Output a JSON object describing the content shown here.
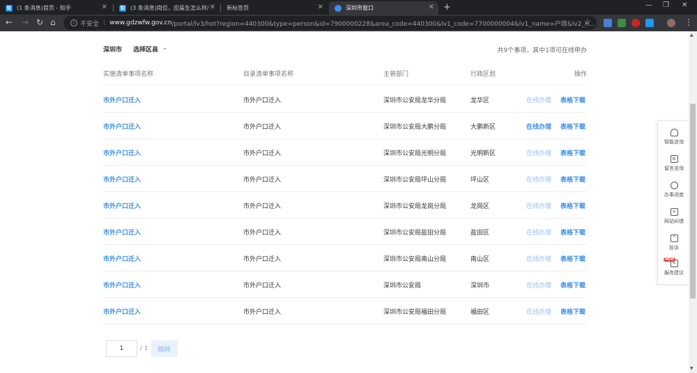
{
  "browser": {
    "tabs": [
      {
        "title": "(1 条消息)首页 - 知乎",
        "favicon": "知",
        "active": false
      },
      {
        "title": "(3 条消息)岗位，应届生怎么样/ ...",
        "favicon": "知",
        "active": false
      },
      {
        "title": "新标签页",
        "favicon": "",
        "active": false
      },
      {
        "title": "深圳市窗口",
        "favicon": "gov",
        "active": true
      }
    ],
    "security_label": "不安全",
    "url_domain": "www.gdzwfw.gov.cn",
    "url_path": "/portal/lv3/hot?region=440300&type=person&id=7900000228&area_code=440300&lv1_code=7700000004&lv1_name=户政&lv2_n..."
  },
  "filter": {
    "city": "深圳市",
    "district_label": "选择区县",
    "summary": "共9个事项，其中1项可在线申办"
  },
  "table": {
    "headers": [
      "实施清单事项名称",
      "目录清单事项名称",
      "主管部门",
      "行政区划",
      "操作"
    ],
    "rows": [
      {
        "name": "市外户口迁入",
        "catalog": "市外户口迁入",
        "dept": "深圳市公安局龙华分局",
        "region": "龙华区",
        "online": "在线办理",
        "online_enabled": false,
        "download": "表格下载"
      },
      {
        "name": "市外户口迁入",
        "catalog": "市外户口迁入",
        "dept": "深圳市公安局大鹏分局",
        "region": "大鹏新区",
        "online": "在线办理",
        "online_enabled": true,
        "download": "表格下载"
      },
      {
        "name": "市外户口迁入",
        "catalog": "市外户口迁入",
        "dept": "深圳市公安局光明分局",
        "region": "光明新区",
        "online": "在线办理",
        "online_enabled": false,
        "download": "表格下载"
      },
      {
        "name": "市外户口迁入",
        "catalog": "市外户口迁入",
        "dept": "深圳市公安局坪山分局",
        "region": "坪山区",
        "online": "在线办理",
        "online_enabled": false,
        "download": "表格下载"
      },
      {
        "name": "市外户口迁入",
        "catalog": "市外户口迁入",
        "dept": "深圳市公安局龙岗分局",
        "region": "龙岗区",
        "online": "在线办理",
        "online_enabled": false,
        "download": "表格下载"
      },
      {
        "name": "市外户口迁入",
        "catalog": "市外户口迁入",
        "dept": "深圳市公安局盐田分局",
        "region": "盐田区",
        "online": "在线办理",
        "online_enabled": false,
        "download": "表格下载"
      },
      {
        "name": "市外户口迁入",
        "catalog": "市外户口迁入",
        "dept": "深圳市公安局南山分局",
        "region": "南山区",
        "online": "在线办理",
        "online_enabled": false,
        "download": "表格下载"
      },
      {
        "name": "市外户口迁入",
        "catalog": "市外户口迁入",
        "dept": "深圳市公安局",
        "region": "深圳市",
        "online": "在线办理",
        "online_enabled": false,
        "download": "表格下载"
      },
      {
        "name": "市外户口迁入",
        "catalog": "市外户口迁入",
        "dept": "深圳市公安局福田分局",
        "region": "福田区",
        "online": "在线办理",
        "online_enabled": false,
        "download": "表格下载"
      }
    ]
  },
  "pager": {
    "current": "1",
    "total": "/ 1",
    "go_label": "跳转"
  },
  "side_panel": [
    {
      "label": "智能咨询",
      "icon": "headset-icon"
    },
    {
      "label": "留言咨询",
      "icon": "message-icon"
    },
    {
      "label": "办事进度",
      "icon": "progress-icon"
    },
    {
      "label": "网站纠错",
      "icon": "error-report-icon"
    },
    {
      "label": "投诉",
      "icon": "complaint-icon"
    },
    {
      "label": "服务建议",
      "icon": "suggestion-icon",
      "badge": "NEW"
    }
  ],
  "colors": {
    "link": "#3a8ee6",
    "disabled_link": "#b8d6f3",
    "chrome_dark": "#202124"
  }
}
